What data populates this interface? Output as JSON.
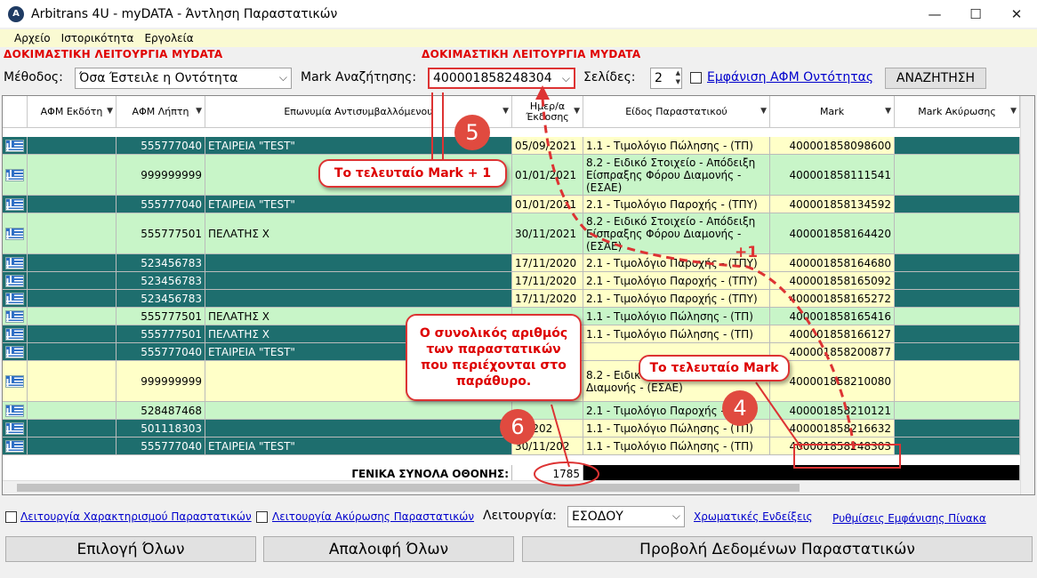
{
  "window": {
    "title": "Arbitrans 4U - myDATA - Άντληση Παραστατικών"
  },
  "menu": [
    "Αρχείο",
    "Ιστορικότητα",
    "Εργολεία"
  ],
  "warning": "ΔΟΚΙΜΑΣΤΙΚΗ ΛΕΙΤΟΥΡΓΙΑ MYDATA",
  "toolbar": {
    "method_label": "Μέθοδος:",
    "method_value": "Όσα Έστειλε η Οντότητα",
    "mark_label": "Mark Αναζήτησης:",
    "mark_value": "400001858248304",
    "pages_label": "Σελίδες:",
    "pages_value": "2",
    "show_afm_label": "Εμφάνιση ΑΦΜ Οντότητας",
    "search_button": "ΑΝΑΖΗΤΗΣΗ"
  },
  "columns": [
    "ΑΦΜ Εκδότη",
    "ΑΦΜ Λήπτη",
    "Επωνυμία Αντισυμβαλλόμενου",
    "Ημερ/α Έκδοσης",
    "Είδος Παραστατικού",
    "Mark",
    "Mark Ακύρωσης"
  ],
  "rows": [
    {
      "receiver": "555777040",
      "name": "ΕΤΑΙΡΕΙΑ \"TEST\"",
      "date": "05/09/2021",
      "kind": "1.1 - Τιμολόγιο Πώλησης - (ΤΠ)",
      "mark": "400001858098600"
    },
    {
      "receiver": "999999999",
      "name": "",
      "date": "01/01/2021",
      "kind": "8.2 - Ειδικό Στοιχείο - Απόδειξη Είσπραξης Φόρου Διαμονής - (ΕΣΑΕ)",
      "mark": "400001858111541"
    },
    {
      "receiver": "555777040",
      "name": "ΕΤΑΙΡΕΙΑ \"TEST\"",
      "date": "01/01/2021",
      "kind": "2.1 - Τιμολόγιο Παροχής - (ΤΠΥ)",
      "mark": "400001858134592"
    },
    {
      "receiver": "555777501",
      "name": "ΠΕΛΑΤΗΣ Χ",
      "date": "30/11/2021",
      "kind": "8.2 - Ειδικό Στοιχείο - Απόδειξη Είσπραξης Φόρου Διαμονής - (ΕΣΑΕ)",
      "mark": "400001858164420"
    },
    {
      "receiver": "523456783",
      "name": "",
      "date": "17/11/2020",
      "kind": "2.1 - Τιμολόγιο Παροχής - (ΤΠΥ)",
      "mark": "400001858164680"
    },
    {
      "receiver": "523456783",
      "name": "",
      "date": "17/11/2020",
      "kind": "2.1 - Τιμολόγιο Παροχής - (ΤΠΥ)",
      "mark": "400001858165092"
    },
    {
      "receiver": "523456783",
      "name": "",
      "date": "17/11/2020",
      "kind": "2.1 - Τιμολόγιο Παροχής - (ΤΠΥ)",
      "mark": "400001858165272"
    },
    {
      "receiver": "555777501",
      "name": "ΠΕΛΑΤΗΣ Χ",
      "date": "",
      "kind": "1.1 - Τιμολόγιο Πώλησης - (ΤΠ)",
      "mark": "400001858165416"
    },
    {
      "receiver": "555777501",
      "name": "ΠΕΛΑΤΗΣ Χ",
      "date": "",
      "kind": "1.1 - Τιμολόγιο Πώλησης - (ΤΠ)",
      "mark": "400001858166127"
    },
    {
      "receiver": "555777040",
      "name": "ΕΤΑΙΡΕΙΑ \"TEST\"",
      "date": "",
      "kind": "",
      "mark": "400001858200877"
    },
    {
      "receiver": "999999999",
      "name": "",
      "date": "",
      "kind": "8.2 - Ειδικό Είσπραξης Φόρου Διαμονής - (ΕΣΑΕ)",
      "mark": "400001858210080"
    },
    {
      "receiver": "528487468",
      "name": "",
      "date": "",
      "kind": "2.1 - Τιμολόγιο Παροχής - (ΤΠΥ)",
      "mark": "400001858210121"
    },
    {
      "receiver": "501118303",
      "name": "",
      "date": "05/202",
      "kind": "1.1 - Τιμολόγιο Πώλησης - (ΤΠ)",
      "mark": "400001858216632"
    },
    {
      "receiver": "555777040",
      "name": "ΕΤΑΙΡΕΙΑ \"TEST\"",
      "date": "30/11/202",
      "kind": "1.1 - Τιμολόγιο Πώλησης - (ΤΠ)",
      "mark": "400001858248303"
    }
  ],
  "totals": {
    "label": "ΓΕΝΙΚΑ ΣΥΝΟΛΑ ΟΘΟΝΗΣ:",
    "value": "1785"
  },
  "bottom": {
    "char_label": "Λειτουργία Χαρακτηρισμού Παραστατικών",
    "cancel_label": "Λειτουργία Ακύρωσης Παραστατικών",
    "mode_label": "Λειτουργία:",
    "mode_value": "ΕΣΟΔΟΥ",
    "color_link": "Χρωματικές Ενδείξεις",
    "settings_link": "Ρυθμίσεις Εμφάνισης Πίνακα",
    "select_all": "Επιλογή Όλων",
    "clear_all": "Απαλοιφή Όλων",
    "view_data": "Προβολή Δεδομένων Παραστατικών"
  },
  "annotations": {
    "callout_last_plus": "Το τελευταίο Mark + 1",
    "callout_total": "Ο συνολικός αριθμός των παραστατικών που περιέχονται στο παράθυρο.",
    "callout_last": "Το τελευταίο Mark",
    "plus_one": "+1",
    "badge_4": "4",
    "badge_5": "5",
    "badge_6": "6"
  },
  "colors": {
    "dark_row": "#1e6e6e",
    "light_row": "#c8f5c8",
    "yellow_cell": "#ffffc8",
    "warning": "#e00000",
    "annotation": "#e04a3f"
  }
}
